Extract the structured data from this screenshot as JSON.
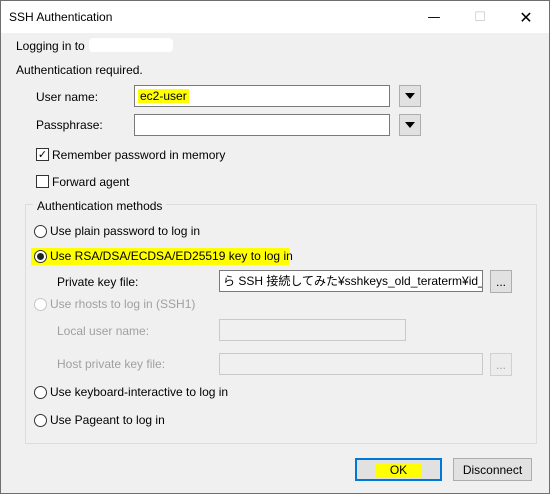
{
  "window": {
    "title": "SSH Authentication",
    "minimize_glyph": "—",
    "maximize_glyph": "☐",
    "close_glyph": "✕"
  },
  "header": {
    "logging_in": "Logging in to",
    "auth_required": "Authentication required."
  },
  "fields": {
    "user_name_label": "User name:",
    "user_name_value": "ec2-user",
    "passphrase_label": "Passphrase:",
    "passphrase_value": ""
  },
  "options": {
    "remember_password": {
      "label": "Remember password in memory",
      "checked": true
    },
    "forward_agent": {
      "label": "Forward agent",
      "checked": false
    }
  },
  "methods": {
    "title": "Authentication methods",
    "plain_password": "Use plain password to log in",
    "rsa_key": "Use RSA/DSA/ECDSA/ED25519 key to log in",
    "private_key_label": "Private key file:",
    "private_key_value": "ら SSH 接続してみた¥sshkeys_old_teraterm¥id_rsa",
    "browse_label": "...",
    "rhosts": "Use rhosts to log in (SSH1)",
    "local_user_label": "Local user name:",
    "host_key_label": "Host private key file:",
    "keyboard_interactive": "Use keyboard-interactive to log in",
    "pageant": "Use Pageant to log in",
    "selected": "rsa_key"
  },
  "buttons": {
    "ok": "OK",
    "disconnect": "Disconnect"
  },
  "colors": {
    "highlight": "#ffff00",
    "ok_border": "#0078d7"
  }
}
